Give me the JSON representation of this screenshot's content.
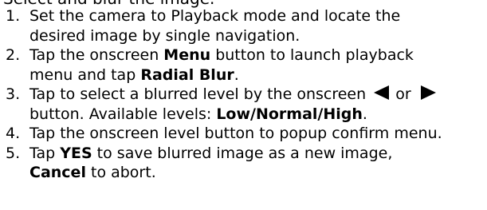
{
  "heading": "Select and blur the image.",
  "steps": [
    {
      "number": "1.",
      "lines": [
        {
          "text": "Set the camera to Playback mode and locate the"
        },
        {
          "text": "desired image by single navigation."
        }
      ]
    },
    {
      "number": "2.",
      "lines": [
        {
          "before": "Tap the onscreen ",
          "bold": "Menu",
          "after": " button to launch playback"
        },
        {
          "before": "menu and tap ",
          "bold": "Radial Blur",
          "after": "."
        }
      ]
    },
    {
      "number": "3.",
      "lines": [
        {
          "before": "Tap to select a blurred level by the onscreen ",
          "left_icon": "left-arrow-icon",
          "middle": " or ",
          "right_icon": "right-arrow-icon"
        },
        {
          "before": "button. Available levels: ",
          "bold": "Low/Normal/High",
          "after": "."
        }
      ]
    },
    {
      "number": "4.",
      "lines": [
        {
          "text": "Tap the onscreen level button to popup confirm menu."
        }
      ]
    },
    {
      "number": "5.",
      "lines": [
        {
          "before": "Tap ",
          "bold": "YES",
          "after": " to save blurred image as a new image,"
        },
        {
          "bold": "Cancel",
          "after": " to abort."
        }
      ]
    }
  ]
}
